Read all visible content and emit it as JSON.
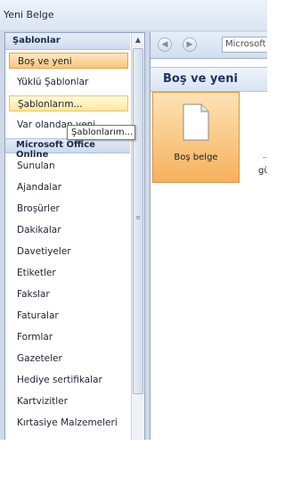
{
  "window": {
    "title": "Yeni Belge"
  },
  "sidebar": {
    "header": "Şablonlar",
    "items": [
      {
        "label": "Boş ve yeni",
        "state": "selected"
      },
      {
        "label": "Yüklü Şablonlar",
        "state": "normal"
      },
      {
        "label": "Şablonlarım...",
        "state": "hover"
      },
      {
        "label": "Var olandan yeni...",
        "state": "normal"
      }
    ],
    "online_header": "Microsoft Office Online",
    "online_items": [
      "Sunulan",
      "Ajandalar",
      "Broşürler",
      "Dakikalar",
      "Davetiyeler",
      "Etiketler",
      "Fakslar",
      "Faturalar",
      "Formlar",
      "Gazeteler",
      "Hediye sertifikalar",
      "Kartvizitler",
      "Kırtasiye Malzemeleri"
    ],
    "tooltip": "Şablonlarım..."
  },
  "main": {
    "address": "Microsoft",
    "heading": "Boş ve yeni",
    "tile_label": "Boş belge",
    "peek_text": "gün",
    "peek_text_top": "..."
  },
  "colors": {
    "selected_bg": "#f8c77a",
    "hover_bg": "#ffe79a",
    "heading_text": "#1b3565",
    "frame": "#cfd8e6"
  }
}
